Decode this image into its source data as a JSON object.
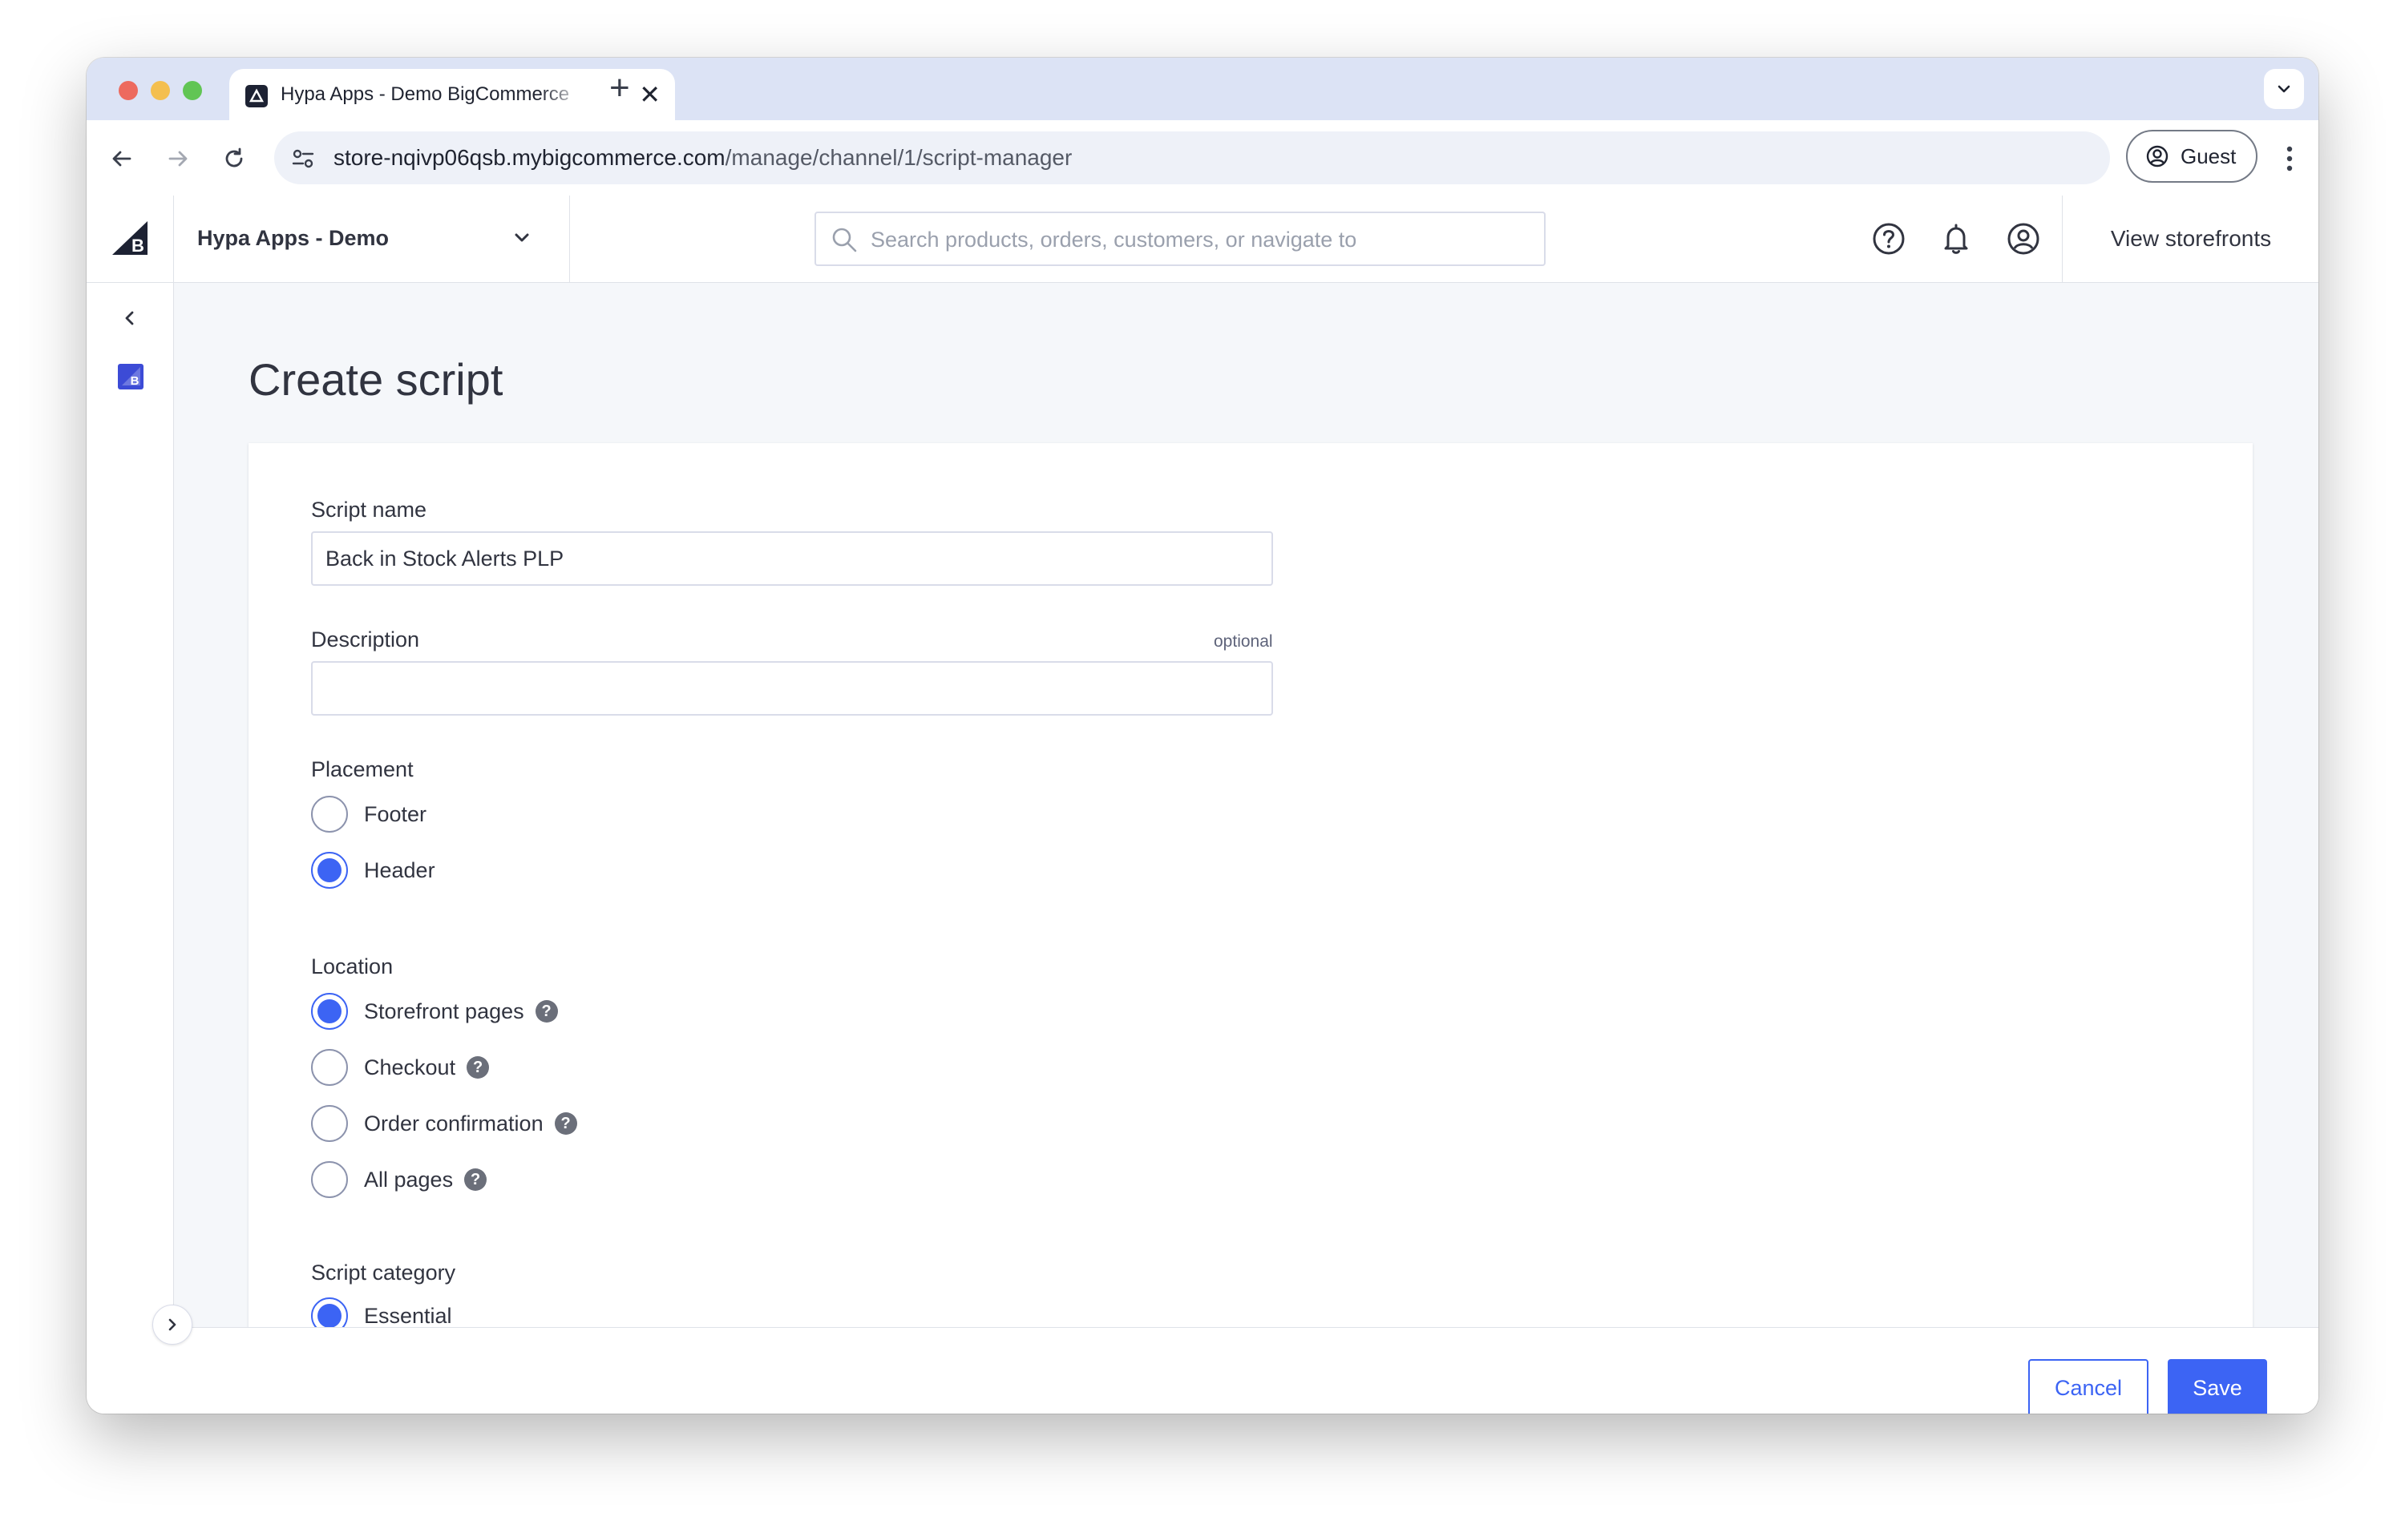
{
  "browser": {
    "tab_title": "Hypa Apps - Demo BigCommerce",
    "tab_close": "✕",
    "new_tab": "+",
    "url_host": "store-nqivp06qsb.mybigcommerce.com",
    "url_path": "/manage/channel/1/script-manager",
    "profile_label": "Guest"
  },
  "header": {
    "store_name": "Hypa Apps - Demo",
    "search_placeholder": "Search products, orders, customers, or navigate to",
    "view_storefronts": "View storefronts"
  },
  "page": {
    "title": "Create script"
  },
  "form": {
    "script_name_label": "Script name",
    "script_name_value": "Back in Stock Alerts PLP",
    "description_label": "Description",
    "description_optional": "optional",
    "description_value": "",
    "placement_label": "Placement",
    "placement_options": [
      {
        "label": "Footer",
        "checked": false
      },
      {
        "label": "Header",
        "checked": true
      }
    ],
    "location_label": "Location",
    "location_options": [
      {
        "label": "Storefront pages",
        "checked": true
      },
      {
        "label": "Checkout",
        "checked": false
      },
      {
        "label": "Order confirmation",
        "checked": false
      },
      {
        "label": "All pages",
        "checked": false
      }
    ],
    "help_glyph": "?",
    "category_label": "Script category",
    "category_options": [
      {
        "label": "Essential",
        "checked": true
      }
    ]
  },
  "actions": {
    "cancel_label": "Cancel",
    "save_label": "Save"
  },
  "colors": {
    "accent": "#3c64f4",
    "tabstrip": "#dce3f5",
    "page_bg": "#f5f7fa",
    "text": "#313440"
  }
}
